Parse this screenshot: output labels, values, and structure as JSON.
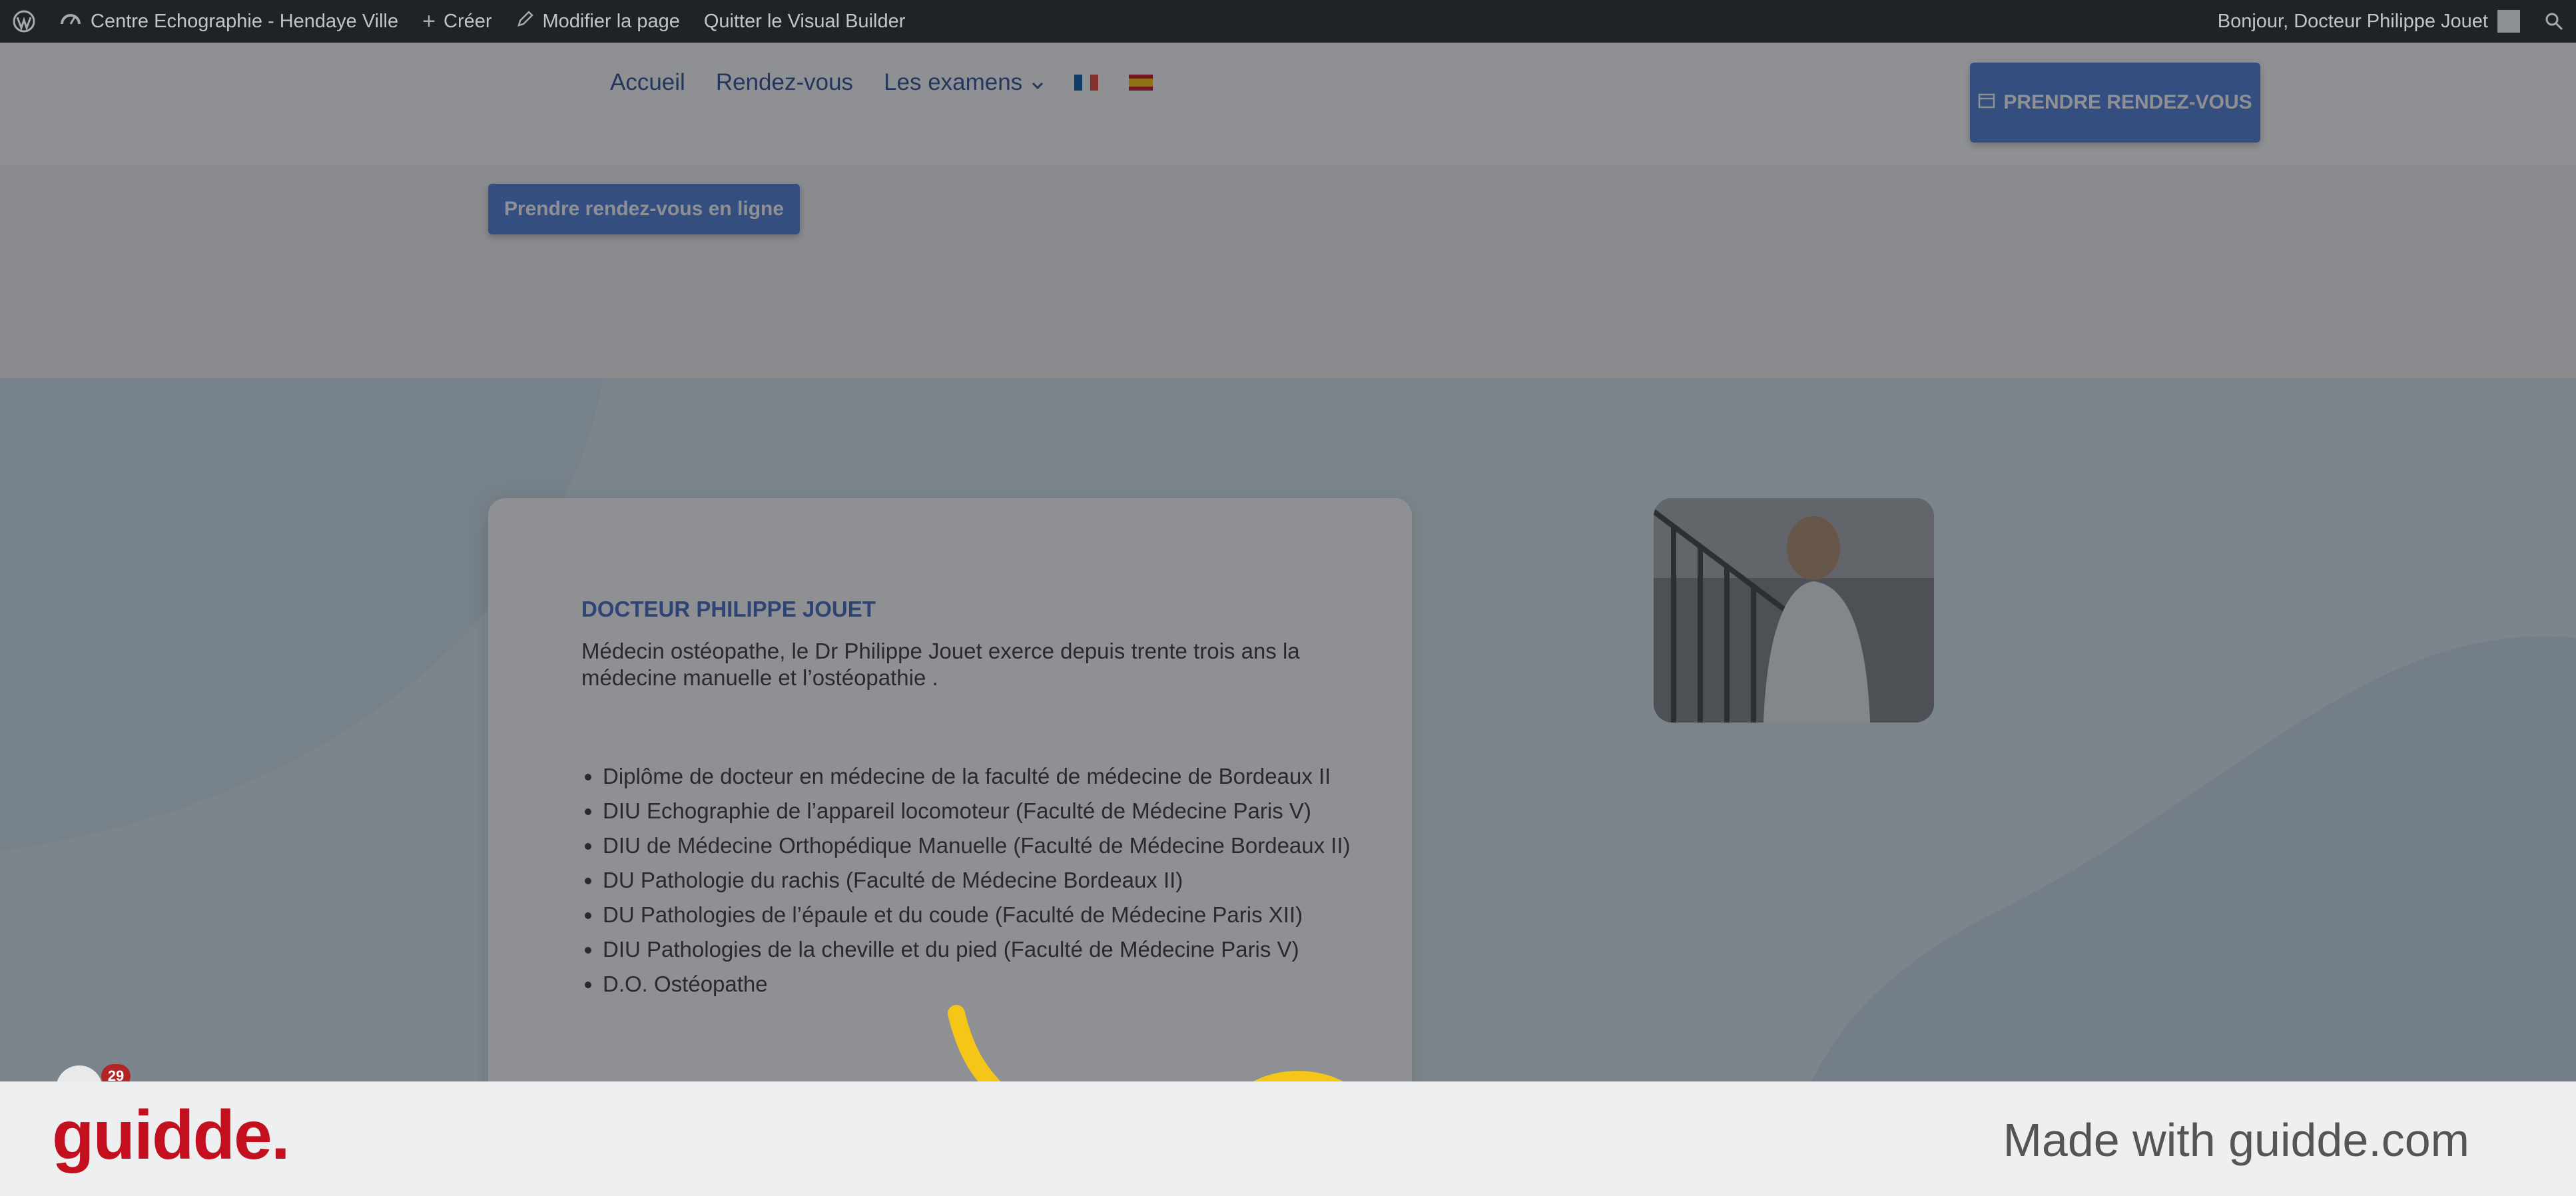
{
  "admin_bar": {
    "site_name": "Centre Echographie - Hendaye Ville",
    "create": "Créer",
    "edit_page": "Modifier la page",
    "quit_builder": "Quitter le Visual Builder",
    "greeting": "Bonjour, Docteur Philippe Jouet"
  },
  "nav": {
    "items": [
      "Accueil",
      "Rendez-vous",
      "Les examens"
    ]
  },
  "header_cta": "PRENDRE RENDEZ-VOUS",
  "online_button": "Prendre rendez-vous en ligne",
  "card": {
    "title": "DOCTEUR PHILIPPE JOUET",
    "intro": "Médecin ostéopathe, le Dr Philippe Jouet exerce depuis trente trois ans la médecine manuelle et l’ostéopathie .",
    "list": [
      "Diplôme de docteur en médecine de la faculté de médecine de Bordeaux II",
      "DIU Echographie de l’appareil locomoteur (Faculté de Médecine Paris V)",
      "DIU de Médecine Orthopédique Manuelle (Faculté de Médecine Bordeaux II)",
      "DU Pathologie du rachis (Faculté de Médecine Bordeaux II)",
      "DU Pathologies de l’épaule et du coude (Faculté de Médecine Paris XII)",
      "DIU Pathologies de la cheville et du pied (Faculté de Médecine Paris V)",
      "D.O. Ostéopathe"
    ]
  },
  "notification_count": "29",
  "footer": {
    "logo": "guidde.",
    "made_with": "Made with guidde.com"
  },
  "colors": {
    "accent": "#4d7bd8",
    "title_blue": "#3f67c2",
    "admin_bar": "#1d2327",
    "guidde_red": "#c4101e"
  }
}
